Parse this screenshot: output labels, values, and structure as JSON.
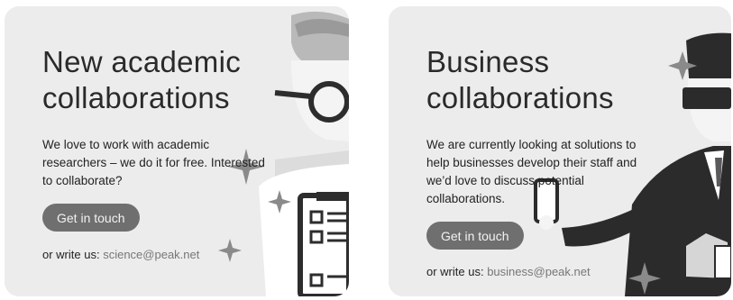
{
  "academic": {
    "title": "New academic\ncollaborations",
    "description": "We love to work with academic\nresearchers – we do it for free. Interested\nto collaborate?",
    "button_label": "Get in touch",
    "write_prefix": "or write us:",
    "email": "science@peak.net"
  },
  "business": {
    "title": "Business\ncollaborations",
    "description": "We are currently looking at solutions to\nhelp businesses develop their staff and\nwe’d love to discuss potential\ncollaborations.",
    "button_label": "Get in touch",
    "write_prefix": "or write us:",
    "email": "business@peak.net"
  },
  "colors": {
    "card_bg": "#ececec",
    "button_bg": "#6f6f6f",
    "suit": "#2b2b2b",
    "email_text": "#777777"
  },
  "icons": [
    "sparkle-icon",
    "scientist-illustration",
    "businessman-illustration",
    "phone-icon"
  ]
}
